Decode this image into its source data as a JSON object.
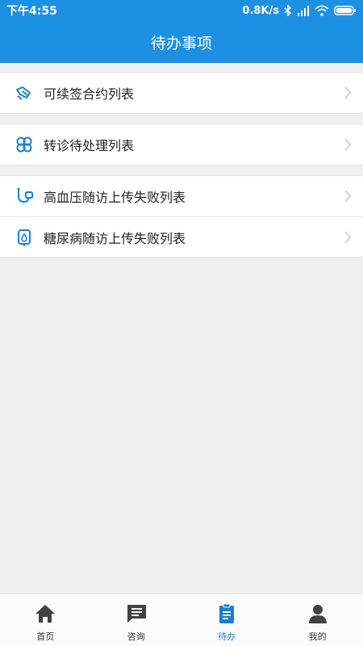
{
  "status": {
    "time": "下午4:55",
    "speed": "0.8K/s"
  },
  "header": {
    "title": "待办事项"
  },
  "groups": [
    {
      "items": [
        {
          "label": "可续签合约列表",
          "icon": "handshake-icon"
        }
      ]
    },
    {
      "items": [
        {
          "label": "转诊待处理列表",
          "icon": "transfer-icon"
        }
      ]
    },
    {
      "items": [
        {
          "label": "高血压随访上传失败列表",
          "icon": "blood-pressure-icon"
        },
        {
          "label": "糖尿病随访上传失败列表",
          "icon": "blood-drop-icon"
        }
      ]
    }
  ],
  "tabs": [
    {
      "label": "首页",
      "icon": "home-icon"
    },
    {
      "label": "咨询",
      "icon": "chat-icon"
    },
    {
      "label": "待办",
      "icon": "clipboard-icon",
      "active": true
    },
    {
      "label": "我的",
      "icon": "person-icon"
    }
  ],
  "colors": {
    "primary": "#1e90e4",
    "accent_icon": "#1a7fd0",
    "tab_inactive": "#424242",
    "background": "#efefef"
  }
}
